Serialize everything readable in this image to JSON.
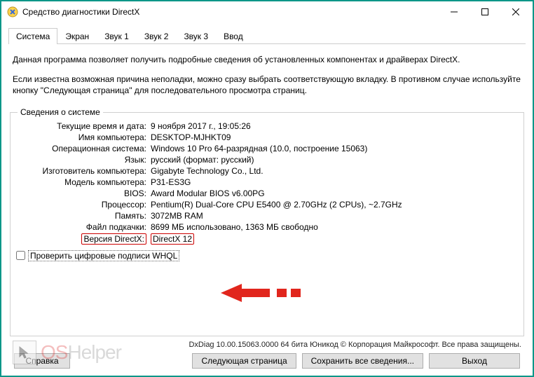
{
  "titlebar": {
    "title": "Средство диагностики DirectX"
  },
  "tabs": [
    "Система",
    "Экран",
    "Звук 1",
    "Звук 2",
    "Звук 3",
    "Ввод"
  ],
  "intro": {
    "p1": "Данная программа позволяет получить подробные сведения об установленных компонентах и драйверах DirectX.",
    "p2": "Если известна возможная причина неполадки, можно сразу выбрать соответствующую вкладку. В противном случае используйте кнопку \"Следующая страница\" для последовательного просмотра страниц."
  },
  "fieldset": {
    "legend": "Сведения о системе"
  },
  "rows": {
    "datetime": {
      "label": "Текущие время и дата:",
      "value": "9 ноября 2017 г., 19:05:26"
    },
    "computer": {
      "label": "Имя компьютера:",
      "value": "DESKTOP-MJHKT09"
    },
    "os": {
      "label": "Операционная система:",
      "value": "Windows 10 Pro 64-разрядная (10.0, построение 15063)"
    },
    "lang": {
      "label": "Язык:",
      "value": "русский (формат: русский)"
    },
    "mfr": {
      "label": "Изготовитель компьютера:",
      "value": "Gigabyte Technology Co., Ltd."
    },
    "model": {
      "label": "Модель компьютера:",
      "value": "P31-ES3G"
    },
    "bios": {
      "label": "BIOS:",
      "value": "Award Modular BIOS v6.00PG"
    },
    "cpu": {
      "label": "Процессор:",
      "value": "Pentium(R) Dual-Core  CPU      E5400  @ 2.70GHz (2 CPUs), ~2.7GHz"
    },
    "mem": {
      "label": "Память:",
      "value": "3072MB RAM"
    },
    "page": {
      "label": "Файл подкачки:",
      "value": "8699 МБ использовано, 1363 МБ свободно"
    },
    "dx": {
      "label": "Версия DirectX:",
      "value": "DirectX 12"
    }
  },
  "checkbox": {
    "label": "Проверить цифровые подписи WHQL"
  },
  "footer": "DxDiag 10.00.15063.0000 64 бита Юникод © Корпорация Майкрософт. Все права защищены.",
  "buttons": {
    "help": "Справка",
    "next": "Следующая страница",
    "save": "Сохранить все сведения...",
    "exit": "Выход"
  },
  "watermark": {
    "os": "OS",
    "helper": "Helper"
  }
}
